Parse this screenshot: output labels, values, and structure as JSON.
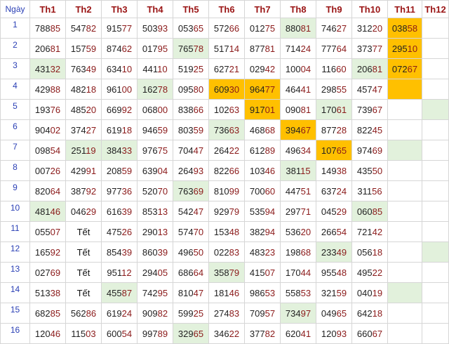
{
  "table": {
    "header": [
      "Ngày",
      "Th1",
      "Th2",
      "Th3",
      "Th4",
      "Th5",
      "Th6",
      "Th7",
      "Th8",
      "Th9",
      "Th10",
      "Th11",
      "Th12"
    ],
    "rows": [
      {
        "day": "1",
        "cells": [
          "78885",
          "54782",
          "91577",
          "50393",
          "05365",
          "57266",
          "01275",
          "88081",
          "74627",
          "31220",
          "03858",
          ""
        ]
      },
      {
        "day": "2",
        "cells": [
          "20681",
          "15759",
          "87462",
          "01795",
          "76578",
          "51714",
          "87781",
          "71424",
          "77764",
          "37377",
          "29510",
          ""
        ]
      },
      {
        "day": "3",
        "cells": [
          "43132",
          "76349",
          "63410",
          "44110",
          "51925",
          "62721",
          "02942",
          "10004",
          "11660",
          "20681",
          "07267",
          ""
        ]
      },
      {
        "day": "4",
        "cells": [
          "42988",
          "48218",
          "96100",
          "16278",
          "09580",
          "60930",
          "96477",
          "46441",
          "29855",
          "45747",
          "",
          ""
        ]
      },
      {
        "day": "5",
        "cells": [
          "19376",
          "48520",
          "66992",
          "06800",
          "83866",
          "10263",
          "91701",
          "09081",
          "17061",
          "73967",
          "",
          ""
        ]
      },
      {
        "day": "6",
        "cells": [
          "90402",
          "37427",
          "61918",
          "94659",
          "80359",
          "73663",
          "46868",
          "39467",
          "87728",
          "82245",
          "",
          ""
        ]
      },
      {
        "day": "7",
        "cells": [
          "09854",
          "25119",
          "38433",
          "97675",
          "70447",
          "26422",
          "61289",
          "49634",
          "10765",
          "97469",
          "",
          ""
        ]
      },
      {
        "day": "8",
        "cells": [
          "00726",
          "42991",
          "20859",
          "63904",
          "26493",
          "82266",
          "10346",
          "38115",
          "14938",
          "43550",
          "",
          ""
        ]
      },
      {
        "day": "9",
        "cells": [
          "82064",
          "38792",
          "97736",
          "52070",
          "76369",
          "81099",
          "70060",
          "44751",
          "63724",
          "31156",
          "",
          ""
        ]
      },
      {
        "day": "10",
        "cells": [
          "48146",
          "04629",
          "61639",
          "85313",
          "54247",
          "92979",
          "53594",
          "29771",
          "04529",
          "06085",
          "",
          ""
        ]
      },
      {
        "day": "11",
        "cells": [
          "05507",
          "Tết",
          "47526",
          "29013",
          "57470",
          "15348",
          "38294",
          "53620",
          "26654",
          "72142",
          "",
          ""
        ]
      },
      {
        "day": "12",
        "cells": [
          "16592",
          "Tết",
          "85439",
          "86039",
          "49650",
          "02283",
          "48323",
          "19868",
          "23349",
          "05618",
          "",
          ""
        ]
      },
      {
        "day": "13",
        "cells": [
          "02769",
          "Tết",
          "95112",
          "29405",
          "68664",
          "35879",
          "41507",
          "17044",
          "95548",
          "49522",
          "",
          ""
        ]
      },
      {
        "day": "14",
        "cells": [
          "51338",
          "Tết",
          "45587",
          "74295",
          "81047",
          "18146",
          "98653",
          "55853",
          "32159",
          "04019",
          "",
          ""
        ]
      },
      {
        "day": "15",
        "cells": [
          "68285",
          "56286",
          "61924",
          "90982",
          "59925",
          "27483",
          "70957",
          "73497",
          "04965",
          "64218",
          "",
          ""
        ]
      },
      {
        "day": "16",
        "cells": [
          "12046",
          "11503",
          "60054",
          "99789",
          "32965",
          "34622",
          "37782",
          "62041",
          "12093",
          "66067",
          "",
          ""
        ]
      }
    ],
    "highlights": {
      "green": [
        "1-8",
        "2-5",
        "3-1",
        "3-10",
        "4-4",
        "5-9",
        "5-12",
        "6-6",
        "7-2",
        "7-3",
        "7-11",
        "8-8",
        "9-5",
        "10-1",
        "10-10",
        "12-9",
        "12-12",
        "13-6",
        "14-3",
        "14-11",
        "15-8",
        "16-5"
      ],
      "orange": [
        "1-11",
        "2-11",
        "3-11",
        "4-6",
        "4-7",
        "4-11",
        "5-7",
        "6-8",
        "7-9"
      ]
    },
    "colors": {
      "green": "#e2f1dc",
      "orange": "#ffc000",
      "header_text": "#9a1414",
      "day_text": "#2a3fb5"
    }
  }
}
